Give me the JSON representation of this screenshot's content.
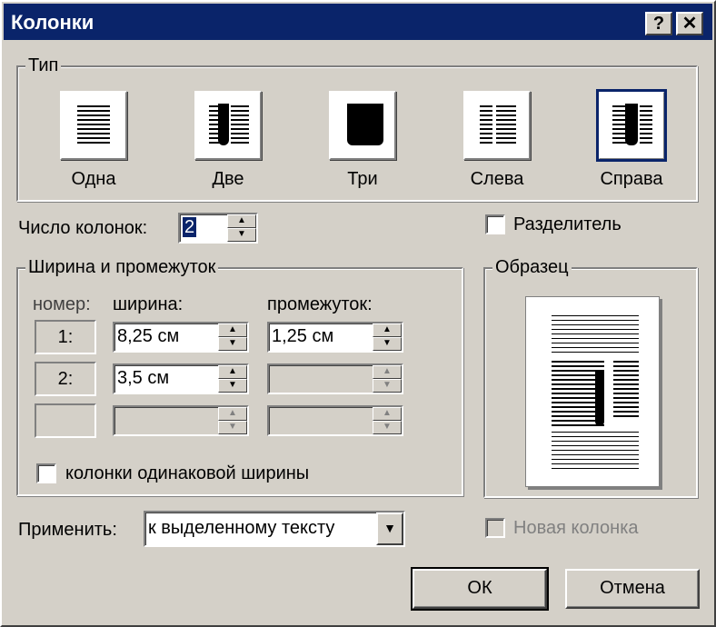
{
  "window": {
    "title": "Колонки",
    "help_button": "?",
    "close_button": "✕"
  },
  "type_group": {
    "label": "Тип",
    "presets": [
      {
        "label": "Одна",
        "selected": false
      },
      {
        "label": "Две",
        "selected": false
      },
      {
        "label": "Три",
        "selected": false
      },
      {
        "label": "Слева",
        "selected": false
      },
      {
        "label": "Справа",
        "selected": true
      }
    ]
  },
  "num_columns": {
    "label": "Число колонок:",
    "value": "2"
  },
  "separator": {
    "label": "Разделитель",
    "checked": false
  },
  "width_group": {
    "label": "Ширина и промежуток",
    "headers": {
      "number": "номер:",
      "width": "ширина:",
      "spacing": "промежуток:"
    },
    "rows": [
      {
        "number": "1:",
        "width": "8,25 см",
        "spacing": "1,25 см"
      },
      {
        "number": "2:",
        "width": "3,5 см",
        "spacing": ""
      },
      {
        "number": "",
        "width": "",
        "spacing": ""
      }
    ],
    "equal_width": {
      "label": "колонки одинаковой ширины",
      "checked": false
    }
  },
  "preview_group": {
    "label": "Образец"
  },
  "apply": {
    "label": "Применить:",
    "value": "к выделенному тексту",
    "dropdown_icon": "triangle-down-icon"
  },
  "new_column": {
    "label": "Новая колонка",
    "checked": false,
    "enabled": false
  },
  "buttons": {
    "ok": "ОК",
    "cancel": "Отмена"
  },
  "colors": {
    "face": "#d4d0c8",
    "title_bar": "#0a246a",
    "title_text": "#ffffff",
    "disabled_text": "#808080"
  }
}
